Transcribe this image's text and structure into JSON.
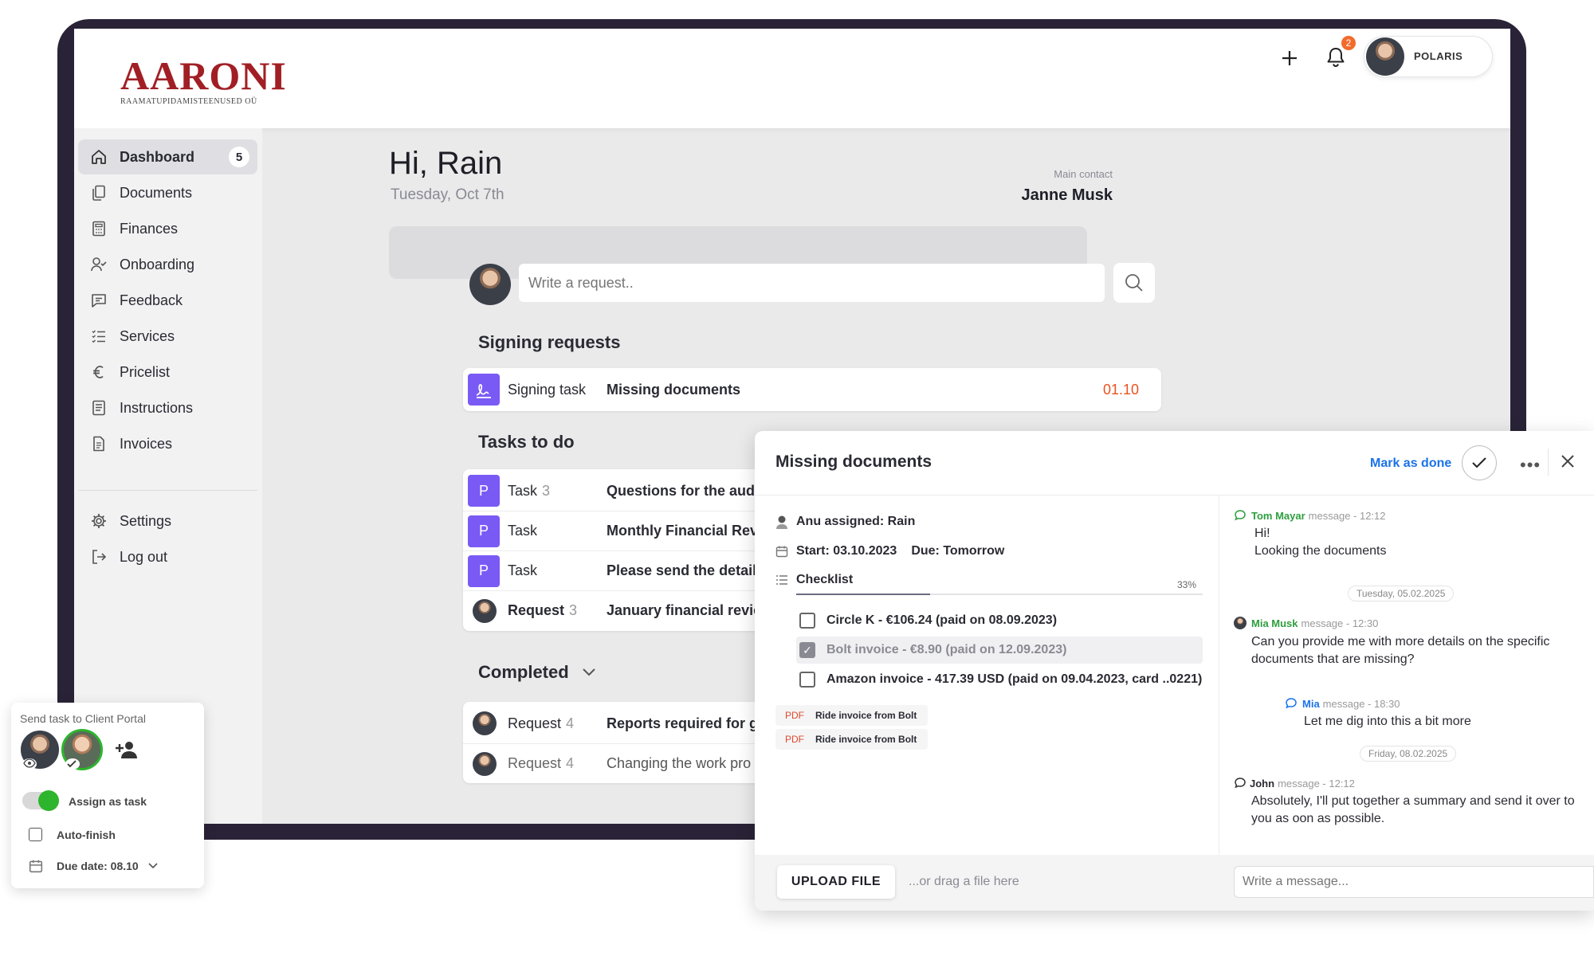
{
  "brand": {
    "name": "AARONI",
    "subtitle": "RAAMATUPIDAMISTEENUSED OÜ"
  },
  "header": {
    "notifications_count": "2",
    "profile_name": "POLARIS",
    "icons": [
      "plus-icon",
      "bell-icon"
    ]
  },
  "sidebar": {
    "items": [
      {
        "label": "Dashboard",
        "icon": "home-icon",
        "badge": "5",
        "active": true
      },
      {
        "label": "Documents",
        "icon": "documents-icon"
      },
      {
        "label": "Finances",
        "icon": "calculator-icon"
      },
      {
        "label": "Onboarding",
        "icon": "user-check-icon"
      },
      {
        "label": "Feedback",
        "icon": "message-square-icon"
      },
      {
        "label": "Services",
        "icon": "list-icon"
      },
      {
        "label": "Pricelist",
        "icon": "euro-icon"
      },
      {
        "label": "Instructions",
        "icon": "file-lines-icon"
      },
      {
        "label": "Invoices",
        "icon": "invoice-icon"
      }
    ],
    "bottom_items": [
      {
        "label": "Settings",
        "icon": "gear-icon"
      },
      {
        "label": "Log out",
        "icon": "logout-icon"
      }
    ]
  },
  "main": {
    "greeting": "Hi, Rain",
    "date": "Tuesday, Oct 7th",
    "main_contact_label": "Main contact",
    "main_contact_name": "Janne Musk",
    "request_placeholder": "Write a request..",
    "signing": {
      "title": "Signing requests",
      "rows": [
        {
          "type": "Signing task",
          "title": "Missing documents",
          "date": "01.10",
          "date_color": "#e8521f"
        }
      ]
    },
    "tasks": {
      "title": "Tasks to do",
      "rows": [
        {
          "tag": "P",
          "type": "Task",
          "count": "3",
          "title": "Questions for the audi"
        },
        {
          "tag": "P",
          "type": "Task",
          "count": "",
          "title": "Monthly Financial Revi"
        },
        {
          "tag": "P",
          "type": "Task",
          "count": "",
          "title": "Please send the details"
        },
        {
          "tag": "",
          "type": "Request",
          "count": "3",
          "title": "January financial revie"
        }
      ]
    },
    "completed": {
      "title": "Completed",
      "rows": [
        {
          "type": "Request",
          "count": "4",
          "title": "Reports required for gi"
        },
        {
          "type": "Request",
          "count": "4",
          "title": "Changing the work pro"
        }
      ]
    }
  },
  "panel": {
    "title": "Missing documents",
    "mark_done": "Mark as done",
    "assigned": "Anu assigned: Rain",
    "start": "Start: 03.10.2023",
    "due": "Due: Tomorrow",
    "checklist_label": "Checklist",
    "checklist_progress": 0.33,
    "checklist_percent": "33%",
    "checklist": [
      {
        "label": "Circle K - €106.24 (paid on 08.09.2023)",
        "checked": false
      },
      {
        "label": "Bolt invoice - €8.90 (paid on 12.09.2023)",
        "checked": true
      },
      {
        "label": "Amazon invoice - 417.39 USD (paid on 09.04.2023, card ..0221)",
        "checked": false
      }
    ],
    "attachments": [
      {
        "type": "PDF",
        "name": "Ride invoice from Bolt"
      },
      {
        "type": "PDF",
        "name": "Ride invoice from Bolt"
      }
    ],
    "upload_label": "UPLOAD FILE",
    "drag_hint": "...or drag a file here",
    "message_placeholder": "Write a message...",
    "chat": {
      "m1": {
        "name": "Tom Mayar",
        "meta": "message - 12:12",
        "lines": [
          "Hi!",
          "Looking the documents"
        ],
        "color": "#2e9e3e"
      },
      "d1": "Tuesday, 05.02.2025",
      "m2": {
        "name": "Mia Musk",
        "meta": "message - 12:30",
        "lines": [
          "Can you provide me with more details on the specific",
          "documents that are missing?"
        ],
        "color": "#2e9e3e"
      },
      "m3": {
        "name": "Mia",
        "meta": "message - 18:30",
        "lines": [
          "Let me dig into this a bit more"
        ],
        "color": "#1a73e8"
      },
      "d2": "Friday, 08.02.2025",
      "m4": {
        "name": "John",
        "meta": "message - 12:12",
        "lines": [
          "Absolutely, I'll put together a summary and send it over to",
          "you as oon as possible."
        ],
        "color": "#2a2a33"
      }
    }
  },
  "send_card": {
    "title": "Send task to Client Portal",
    "assign_label": "Assign as task",
    "assign_on": true,
    "auto_finish": "Auto-finish",
    "due_date": "Due date: 08.10"
  }
}
